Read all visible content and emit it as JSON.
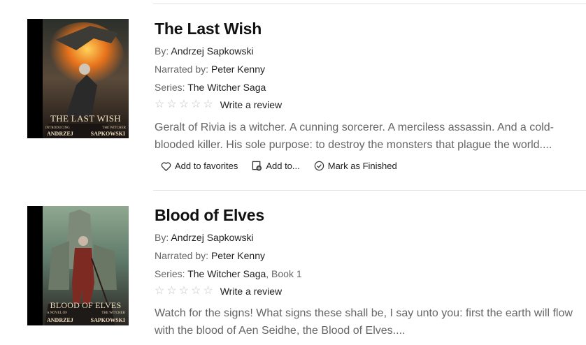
{
  "books": [
    {
      "cover": {
        "title_text": "THE LAST WISH",
        "top_text_left": "INTRODUCING",
        "top_text_right": "THE WITCHER",
        "author_left": "ANDRZEJ",
        "author_right": "SAPKOWSKI",
        "palette": {
          "sky": "#3a3f3a",
          "fire": "#e8731c",
          "glow": "#f6b43a",
          "figure": "#2a2a2a"
        }
      },
      "title": "The Last Wish",
      "by_label": "By:",
      "author": "Andrzej Sapkowski",
      "narrated_label": "Narrated by:",
      "narrator": "Peter Kenny",
      "series_label": "Series:",
      "series": "The Witcher Saga",
      "series_suffix": "",
      "review_link": "Write a review",
      "summary": "Geralt of Rivia is a witcher. A cunning sorcerer. A merciless assassin. And a cold-blooded killer. His sole purpose: to destroy the monsters that plague the world....",
      "actions": {
        "favorites": "Add to favorites",
        "add_to": "Add to...",
        "finished": "Mark as Finished"
      }
    },
    {
      "cover": {
        "title_text": "BLOOD OF ELVES",
        "top_text_left": "A NOVEL OF",
        "top_text_right": "THE WITCHER",
        "author_left": "ANDRZEJ",
        "author_right": "SAPKOWSKI",
        "palette": {
          "sky": "#5f7a6a",
          "fire": "#7c2a22",
          "glow": "#c9c08a",
          "figure": "#3b2a25"
        }
      },
      "title": "Blood of Elves",
      "by_label": "By:",
      "author": "Andrzej Sapkowski",
      "narrated_label": "Narrated by:",
      "narrator": "Peter Kenny",
      "series_label": "Series:",
      "series": "The Witcher Saga",
      "series_suffix": ", Book 1",
      "review_link": "Write a review",
      "summary": "Watch for the signs! What signs these shall be, I say unto you: first the earth will flow with the blood of Aen Seidhe, the Blood of Elves...."
    }
  ],
  "icons": {
    "star": "star-outline-icon",
    "heart": "heart-outline-icon",
    "add": "add-to-list-icon",
    "check": "check-circle-icon"
  }
}
